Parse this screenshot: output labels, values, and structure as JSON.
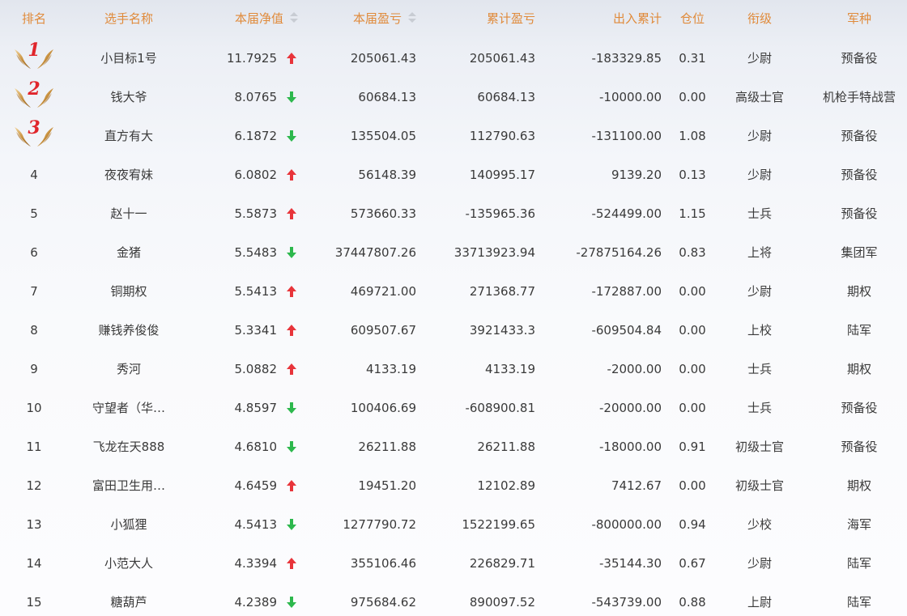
{
  "header": {
    "rank": "排名",
    "name": "选手名称",
    "nav": "本届净值",
    "profit": "本届盈亏",
    "total": "累计盈亏",
    "flow": "出入累计",
    "position": "仓位",
    "level": "衔级",
    "branch": "军种"
  },
  "colors": {
    "header_text": "#e08a3a",
    "up": "#e8343a",
    "down": "#2db84d",
    "medal_number": "#e0252b"
  },
  "rows": [
    {
      "rank": "1",
      "medal": true,
      "name": "小目标1号",
      "nav": "11.7925",
      "trend": "up",
      "profit": "205061.43",
      "total": "205061.43",
      "flow": "-183329.85",
      "position": "0.31",
      "level": "少尉",
      "branch": "预备役"
    },
    {
      "rank": "2",
      "medal": true,
      "name": "钱大爷",
      "nav": "8.0765",
      "trend": "down",
      "profit": "60684.13",
      "total": "60684.13",
      "flow": "-10000.00",
      "position": "0.00",
      "level": "高级士官",
      "branch": "机枪手特战营"
    },
    {
      "rank": "3",
      "medal": true,
      "name": "直方有大",
      "nav": "6.1872",
      "trend": "down",
      "profit": "135504.05",
      "total": "112790.63",
      "flow": "-131100.00",
      "position": "1.08",
      "level": "少尉",
      "branch": "预备役"
    },
    {
      "rank": "4",
      "medal": false,
      "name": "夜夜宥妹",
      "nav": "6.0802",
      "trend": "up",
      "profit": "56148.39",
      "total": "140995.17",
      "flow": "9139.20",
      "position": "0.13",
      "level": "少尉",
      "branch": "预备役"
    },
    {
      "rank": "5",
      "medal": false,
      "name": "赵十一",
      "nav": "5.5873",
      "trend": "up",
      "profit": "573660.33",
      "total": "-135965.36",
      "flow": "-524499.00",
      "position": "1.15",
      "level": "士兵",
      "branch": "预备役"
    },
    {
      "rank": "6",
      "medal": false,
      "name": "金猪",
      "nav": "5.5483",
      "trend": "down",
      "profit": "37447807.26",
      "total": "33713923.94",
      "flow": "-27875164.26",
      "position": "0.83",
      "level": "上将",
      "branch": "集团军"
    },
    {
      "rank": "7",
      "medal": false,
      "name": "铜期权",
      "nav": "5.5413",
      "trend": "up",
      "profit": "469721.00",
      "total": "271368.77",
      "flow": "-172887.00",
      "position": "0.00",
      "level": "少尉",
      "branch": "期权"
    },
    {
      "rank": "8",
      "medal": false,
      "name": "赚钱养俊俊",
      "nav": "5.3341",
      "trend": "up",
      "profit": "609507.67",
      "total": "3921433.3",
      "flow": "-609504.84",
      "position": "0.00",
      "level": "上校",
      "branch": "陆军"
    },
    {
      "rank": "9",
      "medal": false,
      "name": "秀河",
      "nav": "5.0882",
      "trend": "up",
      "profit": "4133.19",
      "total": "4133.19",
      "flow": "-2000.00",
      "position": "0.00",
      "level": "士兵",
      "branch": "期权"
    },
    {
      "rank": "10",
      "medal": false,
      "name": "守望者（华…",
      "nav": "4.8597",
      "trend": "down",
      "profit": "100406.69",
      "total": "-608900.81",
      "flow": "-20000.00",
      "position": "0.00",
      "level": "士兵",
      "branch": "预备役"
    },
    {
      "rank": "11",
      "medal": false,
      "name": "飞龙在天888",
      "nav": "4.6810",
      "trend": "down",
      "profit": "26211.88",
      "total": "26211.88",
      "flow": "-18000.00",
      "position": "0.91",
      "level": "初级士官",
      "branch": "预备役"
    },
    {
      "rank": "12",
      "medal": false,
      "name": "富田卫生用…",
      "nav": "4.6459",
      "trend": "up",
      "profit": "19451.20",
      "total": "12102.89",
      "flow": "7412.67",
      "position": "0.00",
      "level": "初级士官",
      "branch": "期权"
    },
    {
      "rank": "13",
      "medal": false,
      "name": "小狐狸",
      "nav": "4.5413",
      "trend": "down",
      "profit": "1277790.72",
      "total": "1522199.65",
      "flow": "-800000.00",
      "position": "0.94",
      "level": "少校",
      "branch": "海军"
    },
    {
      "rank": "14",
      "medal": false,
      "name": "小范大人",
      "nav": "4.3394",
      "trend": "up",
      "profit": "355106.46",
      "total": "226829.71",
      "flow": "-35144.30",
      "position": "0.67",
      "level": "少尉",
      "branch": "陆军"
    },
    {
      "rank": "15",
      "medal": false,
      "name": "糖葫芦",
      "nav": "4.2389",
      "trend": "down",
      "profit": "975684.62",
      "total": "890097.52",
      "flow": "-543739.00",
      "position": "0.88",
      "level": "上尉",
      "branch": "陆军"
    }
  ]
}
